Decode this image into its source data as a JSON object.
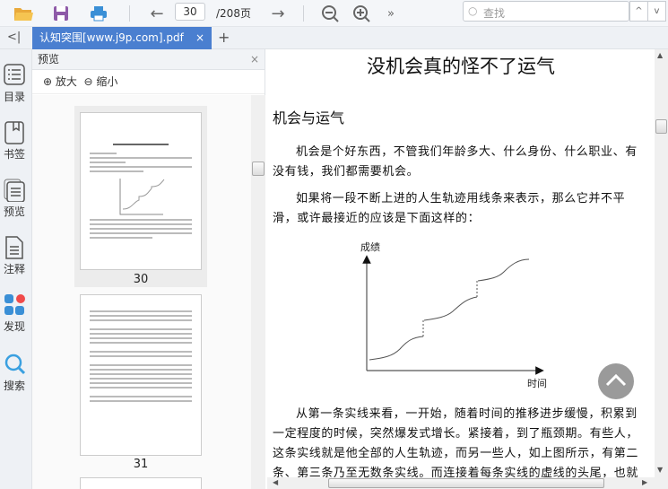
{
  "toolbar": {
    "page_current": "30",
    "page_total": "/208页",
    "more": "»",
    "search_placeholder": "查找",
    "prev_result": "^",
    "next_result": "v"
  },
  "tabs": {
    "collapse": "<|",
    "active": "认知突围[www.j9p.com].pdf",
    "close": "×",
    "add": "+"
  },
  "rail": [
    {
      "label": "目录"
    },
    {
      "label": "书签"
    },
    {
      "label": "预览"
    },
    {
      "label": "注释"
    },
    {
      "label": "发现"
    },
    {
      "label": "搜索"
    }
  ],
  "panel": {
    "title": "预览",
    "close": "×",
    "zoom_in": "放大",
    "zoom_out": "缩小",
    "thumbnails": [
      {
        "page": "30"
      },
      {
        "page": "31"
      }
    ]
  },
  "document": {
    "title": "没机会真的怪不了运气",
    "heading": "机会与运气",
    "paragraphs": [
      "机会是个好东西，不管我们年龄多大、什么身份、什么职业、有没有钱，我们都需要机会。",
      "如果将一段不断上进的人生轨迹用线条来表示，那么它并不平滑，或许最接近的应该是下面这样的：",
      "从第一条实线来看，一开始，随着时间的推移进步缓慢，积累到一定程度的时候，突然爆发式增长。紧接着，到了瓶颈期。有些人，这条实线就是他全部的人生轨迹，而另一些人，如上图所示，有第二条、第三条乃至无数条实线。而连接着每条实线的虚线的头尾，也就"
    ],
    "figure": {
      "y_label": "成绩",
      "x_label": "时间"
    }
  },
  "colors": {
    "accent": "#4a7fd0"
  }
}
